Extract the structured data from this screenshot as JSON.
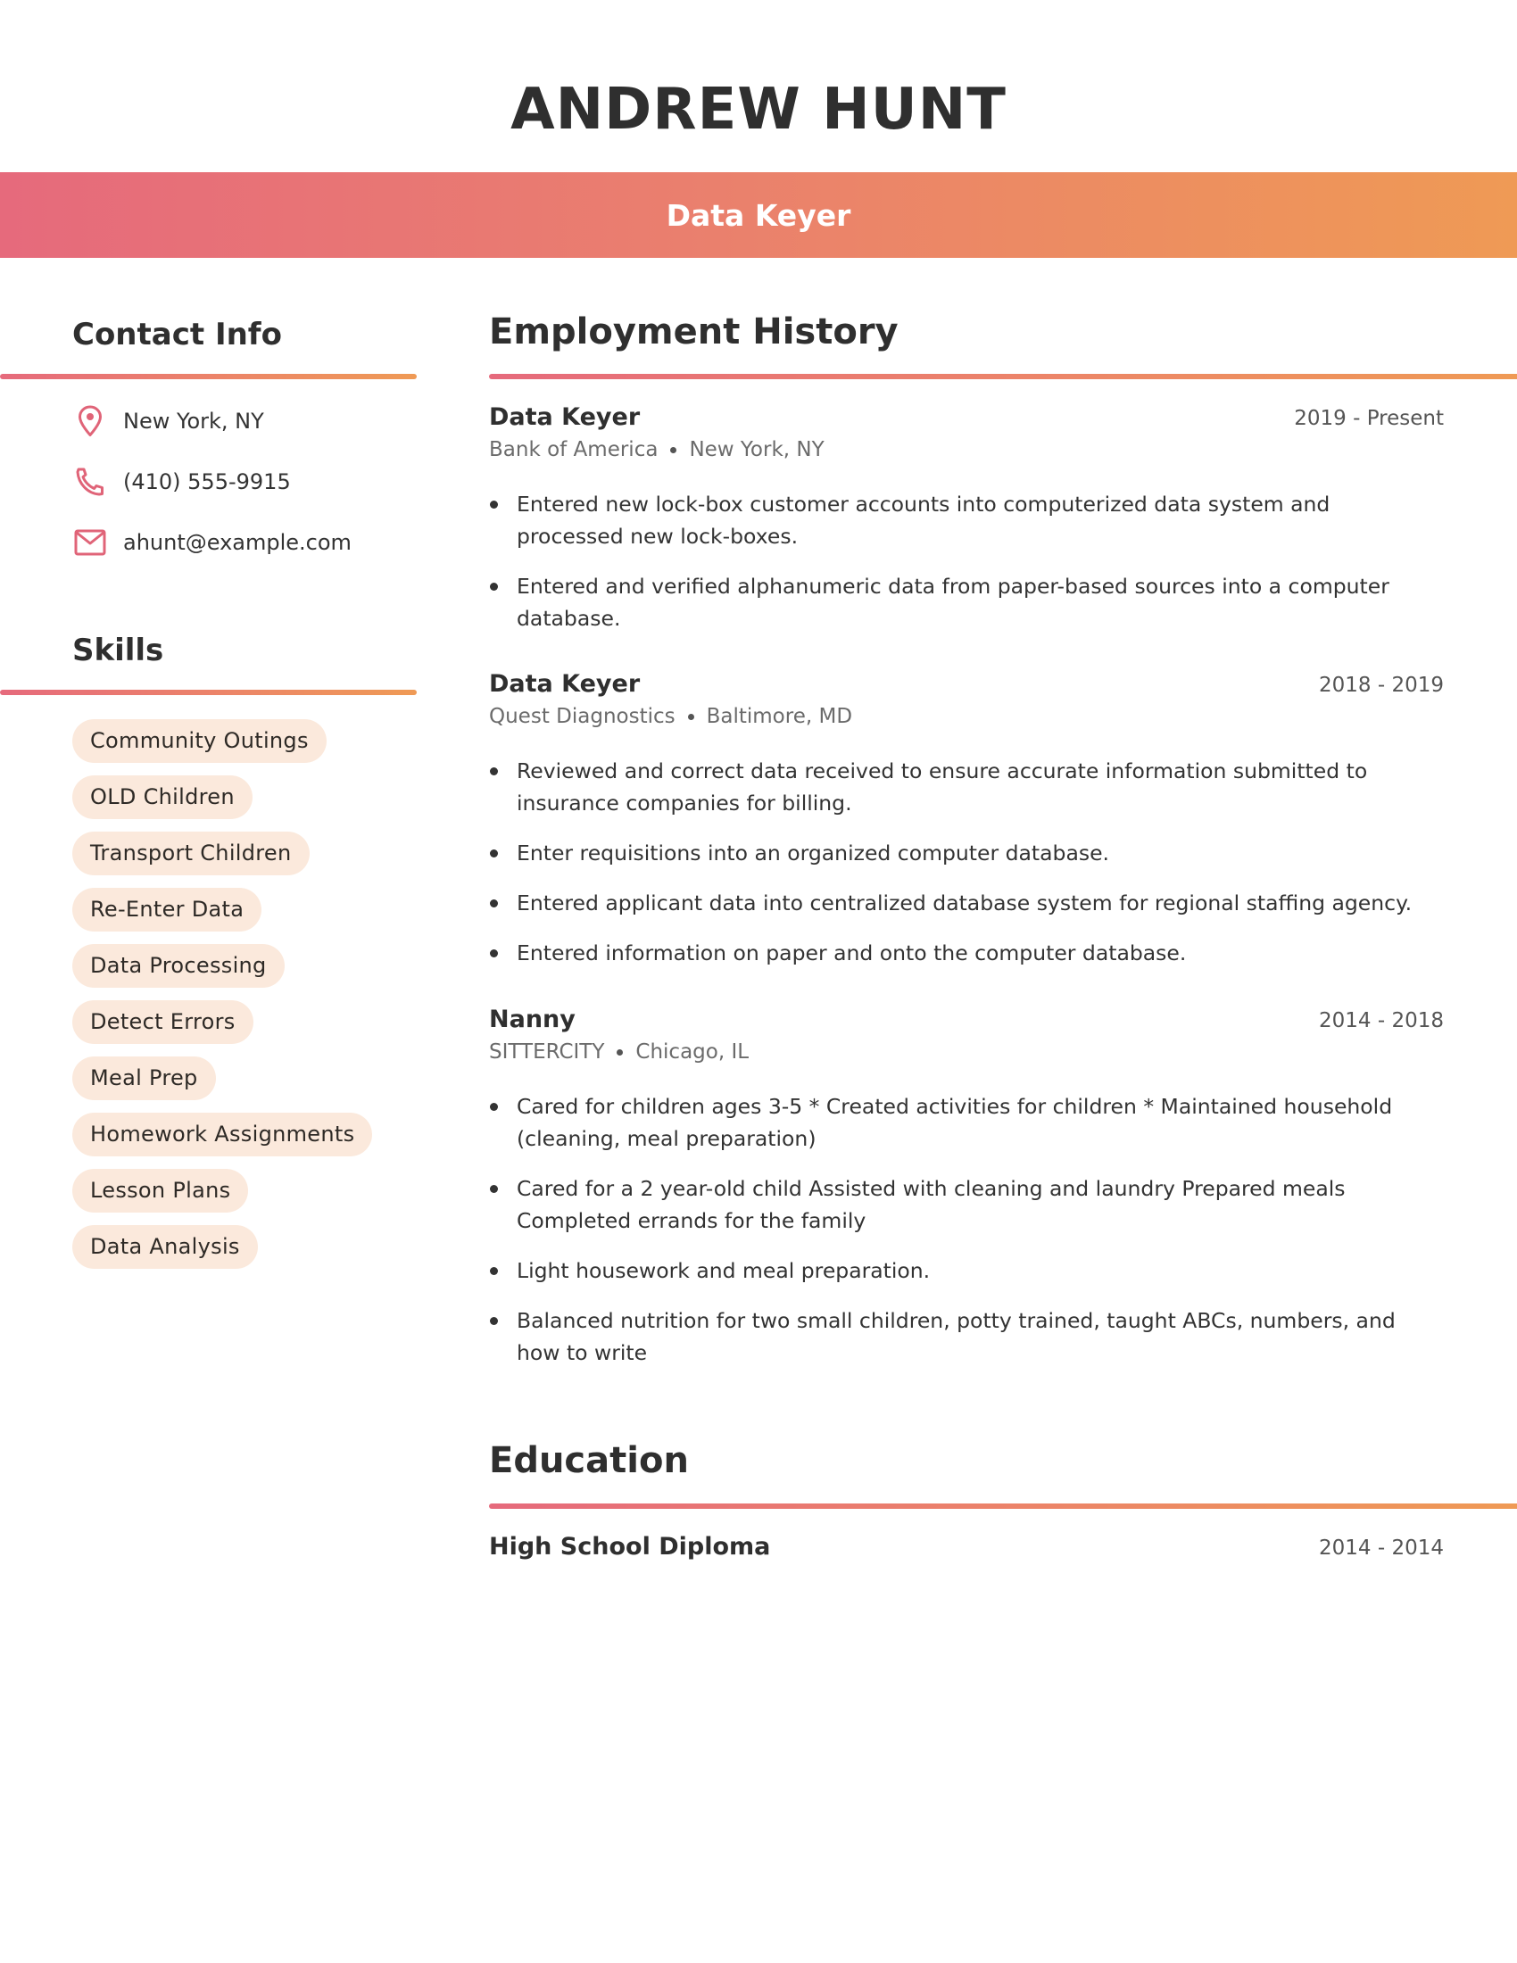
{
  "header": {
    "name": "ANDREW HUNT",
    "job_title": "Data Keyer"
  },
  "theme": {
    "gradient_start": "#e66a7c",
    "gradient_end": "#ef9a55",
    "chip_background": "#fbe9dc",
    "icon_color": "#e06478"
  },
  "contact": {
    "title": "Contact Info",
    "items": [
      {
        "icon": "location-pin-icon",
        "text": "New York, NY"
      },
      {
        "icon": "phone-icon",
        "text": "(410) 555-9915"
      },
      {
        "icon": "envelope-icon",
        "text": "ahunt@example.com"
      }
    ]
  },
  "skills": {
    "title": "Skills",
    "items": [
      "Community Outings",
      "OLD Children",
      "Transport Children",
      "Re-Enter Data",
      "Data Processing",
      "Detect Errors",
      "Meal Prep",
      "Homework Assignments",
      "Lesson Plans",
      "Data Analysis"
    ]
  },
  "employment": {
    "title": "Employment History",
    "jobs": [
      {
        "title": "Data Keyer",
        "dates": "2019 - Present",
        "company": "Bank of America",
        "location": "New York, NY",
        "bullets": [
          "Entered new lock-box customer accounts into computerized data system and processed new lock-boxes.",
          "Entered and verified alphanumeric data from paper-based sources into a computer database."
        ]
      },
      {
        "title": "Data Keyer",
        "dates": "2018 - 2019",
        "company": "Quest Diagnostics",
        "location": "Baltimore, MD",
        "bullets": [
          "Reviewed and correct data received to ensure accurate information submitted to insurance companies for billing.",
          "Enter requisitions into an organized computer database.",
          "Entered applicant data into centralized database system for regional staffing agency.",
          "Entered information on paper and onto the computer database."
        ]
      },
      {
        "title": "Nanny",
        "dates": "2014 - 2018",
        "company": "SITTERCITY",
        "location": "Chicago, IL",
        "bullets": [
          "Cared for children ages 3-5 * Created activities for children * Maintained household (cleaning, meal preparation)",
          "Cared for a 2 year-old child Assisted with cleaning and laundry Prepared meals Completed errands for the family",
          "Light housework and meal preparation.",
          "Balanced nutrition for two small children, potty trained, taught ABCs, numbers, and how to write"
        ]
      }
    ]
  },
  "education": {
    "title": "Education",
    "items": [
      {
        "degree": "High School Diploma",
        "dates": "2014 - 2014"
      }
    ]
  }
}
